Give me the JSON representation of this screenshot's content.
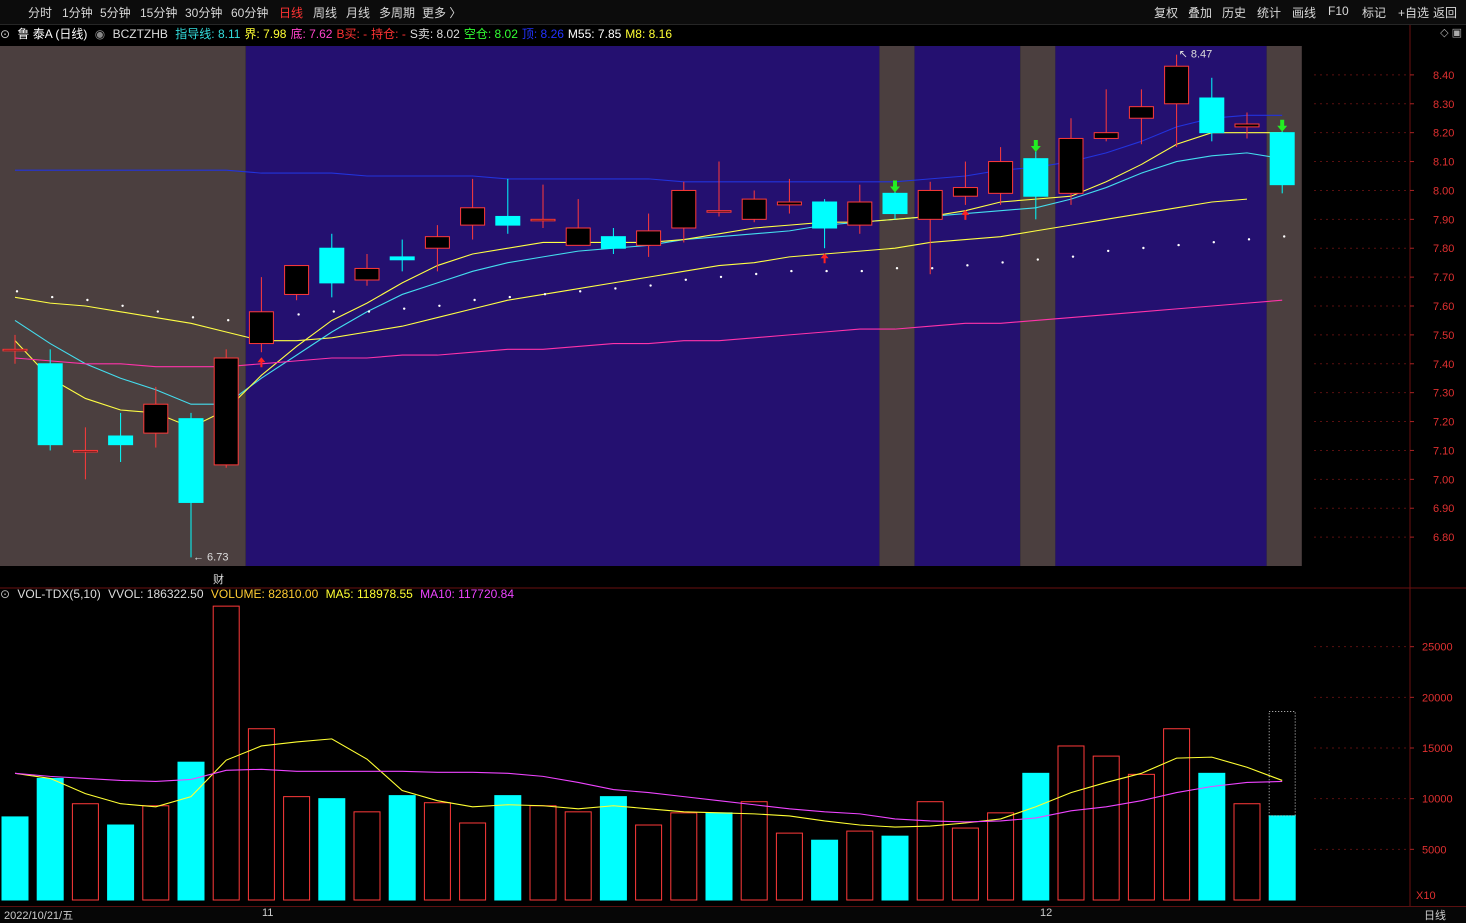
{
  "toolbar": {
    "left": [
      {
        "id": "fenshi",
        "label": "分时",
        "active": false
      },
      {
        "id": "1min",
        "label": "1分钟",
        "active": false
      },
      {
        "id": "5min",
        "label": "5分钟",
        "active": false
      },
      {
        "id": "15min",
        "label": "15分钟",
        "active": false
      },
      {
        "id": "30min",
        "label": "30分钟",
        "active": false
      },
      {
        "id": "60min",
        "label": "60分钟",
        "active": false
      },
      {
        "id": "day",
        "label": "日线",
        "active": true
      },
      {
        "id": "week",
        "label": "周线",
        "active": false
      },
      {
        "id": "month",
        "label": "月线",
        "active": false
      },
      {
        "id": "multi",
        "label": "多周期",
        "active": false
      },
      {
        "id": "more",
        "label": "更多 〉",
        "active": false
      }
    ],
    "right": [
      {
        "id": "fuquan",
        "label": "复权"
      },
      {
        "id": "diejia",
        "label": "叠加"
      },
      {
        "id": "lishi",
        "label": "历史"
      },
      {
        "id": "tongji",
        "label": "统计"
      },
      {
        "id": "huaxian",
        "label": "画线"
      },
      {
        "id": "f10",
        "label": "F10"
      },
      {
        "id": "biaoji",
        "label": "标记"
      },
      {
        "id": "zixuan",
        "label": "+自选"
      },
      {
        "id": "fanhui",
        "label": "返回"
      }
    ]
  },
  "info": {
    "stock": "鲁 泰A (日线)",
    "code": "BCZTZHB",
    "items": [
      {
        "label": "指导线:",
        "value": "8.11",
        "color": "#33dddd"
      },
      {
        "label": "界:",
        "value": "7.98",
        "color": "#ffff33"
      },
      {
        "label": "底:",
        "value": "7.62",
        "color": "#ff44cc"
      },
      {
        "label": "B买:",
        "value": "-",
        "color": "#ff3333"
      },
      {
        "label": "持仓:",
        "value": "-",
        "color": "#ff3333"
      },
      {
        "label": "S卖:",
        "value": "8.02",
        "color": "#dddddd"
      },
      {
        "label": "空仓:",
        "value": "8.02",
        "color": "#33ff33"
      },
      {
        "label": "顶:",
        "value": "8.26",
        "color": "#2233ff"
      },
      {
        "label": "M55:",
        "value": "7.85",
        "color": "#ffffff"
      },
      {
        "label": "M8:",
        "value": "8.16",
        "color": "#ffff33"
      }
    ]
  },
  "vol_info": {
    "name": "VOL-TDX(5,10)",
    "vvol": "VVOL: 186322.50",
    "volume": "VOLUME: 82810.00",
    "ma5": "MA5: 118978.55",
    "ma10": "MA10: 117720.84"
  },
  "annotations": {
    "high": "8.47",
    "low": "6.73",
    "cai": "财",
    "x10": "X10"
  },
  "dates": {
    "first": "2022/10/21/五",
    "m11": "11",
    "m12": "12",
    "period": "日线"
  },
  "colors": {
    "up": "#ff3a3a",
    "down": "#00ffff",
    "bg_gray": "#4b3f3f",
    "bg_blue": "#241070",
    "ma_white": "#ffffff",
    "ma_yellow": "#ffff44",
    "ma_cyan": "#44ddee",
    "ma_blue": "#2233dd",
    "ma_magenta": "#ff33aa"
  },
  "chart_data": [
    {
      "type": "candlestick",
      "title": "鲁 泰A (日线)",
      "ylim": [
        6.7,
        8.5
      ],
      "yticks": [
        6.8,
        6.9,
        7.0,
        7.1,
        7.2,
        7.3,
        7.4,
        7.5,
        7.6,
        7.7,
        7.8,
        7.9,
        8.0,
        8.1,
        8.2,
        8.3,
        8.4
      ],
      "candles": [
        {
          "o": 7.45,
          "c": 7.45,
          "h": 7.5,
          "l": 7.4
        },
        {
          "o": 7.4,
          "c": 7.12,
          "h": 7.45,
          "l": 7.1
        },
        {
          "o": 7.1,
          "c": 7.1,
          "h": 7.18,
          "l": 7.0
        },
        {
          "o": 7.15,
          "c": 7.12,
          "h": 7.23,
          "l": 7.06
        },
        {
          "o": 7.16,
          "c": 7.26,
          "h": 7.32,
          "l": 7.11
        },
        {
          "o": 7.21,
          "c": 6.92,
          "h": 7.23,
          "l": 6.73
        },
        {
          "o": 7.05,
          "c": 7.42,
          "h": 7.45,
          "l": 7.04
        },
        {
          "o": 7.47,
          "c": 7.58,
          "h": 7.7,
          "l": 7.44
        },
        {
          "o": 7.64,
          "c": 7.74,
          "h": 7.74,
          "l": 7.62
        },
        {
          "o": 7.8,
          "c": 7.68,
          "h": 7.85,
          "l": 7.63
        },
        {
          "o": 7.69,
          "c": 7.73,
          "h": 7.78,
          "l": 7.67
        },
        {
          "o": 7.77,
          "c": 7.76,
          "h": 7.83,
          "l": 7.72
        },
        {
          "o": 7.8,
          "c": 7.84,
          "h": 7.88,
          "l": 7.72
        },
        {
          "o": 7.88,
          "c": 7.94,
          "h": 8.04,
          "l": 7.83
        },
        {
          "o": 7.91,
          "c": 7.88,
          "h": 8.04,
          "l": 7.85
        },
        {
          "o": 7.9,
          "c": 7.9,
          "h": 8.02,
          "l": 7.87
        },
        {
          "o": 7.81,
          "c": 7.87,
          "h": 7.97,
          "l": 7.81
        },
        {
          "o": 7.84,
          "c": 7.8,
          "h": 7.87,
          "l": 7.78
        },
        {
          "o": 7.81,
          "c": 7.86,
          "h": 7.92,
          "l": 7.77
        },
        {
          "o": 7.87,
          "c": 8.0,
          "h": 8.03,
          "l": 7.82
        },
        {
          "o": 7.93,
          "c": 7.93,
          "h": 8.1,
          "l": 7.91
        },
        {
          "o": 7.9,
          "c": 7.97,
          "h": 8.0,
          "l": 7.89
        },
        {
          "o": 7.95,
          "c": 7.96,
          "h": 8.04,
          "l": 7.92
        },
        {
          "o": 7.96,
          "c": 7.87,
          "h": 7.97,
          "l": 7.8
        },
        {
          "o": 7.88,
          "c": 7.96,
          "h": 8.02,
          "l": 7.85
        },
        {
          "o": 7.99,
          "c": 7.92,
          "h": 8.0,
          "l": 7.9
        },
        {
          "o": 7.9,
          "c": 8.0,
          "h": 8.03,
          "l": 7.71
        },
        {
          "o": 7.98,
          "c": 8.01,
          "h": 8.1,
          "l": 7.95
        },
        {
          "o": 7.99,
          "c": 8.1,
          "h": 8.15,
          "l": 7.95
        },
        {
          "o": 8.11,
          "c": 7.98,
          "h": 8.14,
          "l": 7.9
        },
        {
          "o": 7.99,
          "c": 8.18,
          "h": 8.25,
          "l": 7.95
        },
        {
          "o": 8.18,
          "c": 8.2,
          "h": 8.35,
          "l": 8.17
        },
        {
          "o": 8.25,
          "c": 8.29,
          "h": 8.35,
          "l": 8.16
        },
        {
          "o": 8.3,
          "c": 8.43,
          "h": 8.47,
          "l": 8.15
        },
        {
          "o": 8.32,
          "c": 8.2,
          "h": 8.39,
          "l": 8.17
        },
        {
          "o": 8.22,
          "c": 8.23,
          "h": 8.27,
          "l": 8.18
        },
        {
          "o": 8.2,
          "c": 8.02,
          "h": 8.21,
          "l": 7.99
        }
      ],
      "ma_white_dots": [
        7.63,
        7.61,
        7.6,
        7.58,
        7.56,
        7.54,
        7.53,
        7.55,
        7.55,
        7.56,
        7.56,
        7.57,
        7.58,
        7.6,
        7.61,
        7.62,
        7.63,
        7.64,
        7.65,
        7.67,
        7.68,
        7.69,
        7.7,
        7.7,
        7.7,
        7.71,
        7.71,
        7.72,
        7.73,
        7.74,
        7.75,
        7.77,
        7.78,
        7.79,
        7.8,
        7.81,
        7.82
      ],
      "series": [
        {
          "color_key": "ma_yellow",
          "values": [
            7.63,
            7.61,
            7.6,
            7.58,
            7.56,
            7.54,
            7.51,
            7.48,
            7.48,
            7.49,
            7.51,
            7.53,
            7.56,
            7.59,
            7.62,
            7.64,
            7.66,
            7.68,
            7.7,
            7.72,
            7.74,
            7.75,
            7.77,
            7.78,
            7.79,
            7.8,
            7.82,
            7.83,
            7.84,
            7.86,
            7.88,
            7.9,
            7.92,
            7.94,
            7.96,
            7.97
          ]
        },
        {
          "color_key": "ma_cyan",
          "values": [
            7.55,
            7.47,
            7.4,
            7.35,
            7.31,
            7.26,
            7.26,
            7.35,
            7.43,
            7.51,
            7.58,
            7.64,
            7.68,
            7.72,
            7.75,
            7.77,
            7.79,
            7.8,
            7.81,
            7.83,
            7.84,
            7.85,
            7.86,
            7.88,
            7.89,
            7.9,
            7.91,
            7.92,
            7.93,
            7.94,
            7.97,
            8.01,
            8.06,
            8.1,
            8.12,
            8.13,
            8.11
          ]
        },
        {
          "color_key": "ma_yellow",
          "values": [
            7.48,
            7.35,
            7.28,
            7.24,
            7.23,
            7.18,
            7.24,
            7.36,
            7.46,
            7.55,
            7.61,
            7.68,
            7.74,
            7.78,
            7.8,
            7.82,
            7.82,
            7.82,
            7.82,
            7.83,
            7.85,
            7.87,
            7.88,
            7.89,
            7.89,
            7.9,
            7.91,
            7.93,
            7.96,
            7.97,
            7.98,
            8.03,
            8.09,
            8.16,
            8.2,
            8.2,
            8.2
          ]
        },
        {
          "color_key": "ma_blue",
          "values": [
            8.07,
            8.07,
            8.07,
            8.07,
            8.07,
            8.07,
            8.07,
            8.06,
            8.06,
            8.06,
            8.05,
            8.05,
            8.05,
            8.05,
            8.04,
            8.04,
            8.04,
            8.04,
            8.04,
            8.03,
            8.03,
            8.03,
            8.03,
            8.03,
            8.03,
            8.03,
            8.04,
            8.05,
            8.07,
            8.08,
            8.1,
            8.13,
            8.17,
            8.22,
            8.25,
            8.26,
            8.26
          ]
        },
        {
          "color_key": "ma_magenta",
          "values": [
            7.42,
            7.41,
            7.4,
            7.4,
            7.39,
            7.39,
            7.39,
            7.4,
            7.41,
            7.42,
            7.42,
            7.43,
            7.43,
            7.44,
            7.45,
            7.45,
            7.46,
            7.47,
            7.47,
            7.48,
            7.48,
            7.49,
            7.5,
            7.51,
            7.52,
            7.52,
            7.53,
            7.54,
            7.54,
            7.55,
            7.56,
            7.57,
            7.58,
            7.59,
            7.6,
            7.61,
            7.62
          ]
        }
      ],
      "signals": [
        {
          "index": 7,
          "type": "buy"
        },
        {
          "index": 23,
          "type": "buy"
        },
        {
          "index": 27,
          "type": "buy"
        },
        {
          "index": 25,
          "type": "sell"
        },
        {
          "index": 29,
          "type": "sell"
        },
        {
          "index": 36,
          "type": "sell"
        }
      ],
      "bg_zones": [
        {
          "from": 0,
          "to": 6,
          "kind": "gray"
        },
        {
          "from": 7,
          "to": 24,
          "kind": "blue"
        },
        {
          "from": 25,
          "to": 25,
          "kind": "gray"
        },
        {
          "from": 26,
          "to": 28,
          "kind": "blue"
        },
        {
          "from": 29,
          "to": 29,
          "kind": "gray"
        },
        {
          "from": 30,
          "to": 35,
          "kind": "blue"
        },
        {
          "from": 36,
          "to": 36,
          "kind": "gray"
        }
      ]
    },
    {
      "type": "bar",
      "title": "VOL-TDX(5,10)",
      "ylim": [
        0,
        30000
      ],
      "yticks": [
        5000,
        10000,
        15000,
        20000,
        25000
      ],
      "unit_label": "X10",
      "values": [
        8200,
        12000,
        9500,
        7400,
        9300,
        13600,
        29000,
        16900,
        10200,
        10000,
        8700,
        10300,
        9600,
        7600,
        10300,
        9300,
        8700,
        10200,
        7400,
        8600,
        8600,
        9700,
        6600,
        5900,
        6800,
        6300,
        9700,
        7100,
        8600,
        12500,
        15200,
        14200,
        12400,
        16900,
        12500,
        9500,
        8300
      ],
      "direction": [
        "down",
        "down",
        "up",
        "down",
        "up",
        "down",
        "up",
        "up",
        "up",
        "down",
        "up",
        "down",
        "up",
        "up",
        "down",
        "up",
        "up",
        "down",
        "up",
        "up",
        "down",
        "up",
        "up",
        "down",
        "up",
        "down",
        "up",
        "up",
        "up",
        "down",
        "up",
        "up",
        "up",
        "up",
        "down",
        "up",
        "down"
      ],
      "series": [
        {
          "name": "MA5",
          "color": "#ffff33",
          "values": [
            12500,
            12000,
            10500,
            9500,
            9200,
            10200,
            13800,
            15200,
            15600,
            15900,
            13900,
            10800,
            9800,
            9200,
            9400,
            9300,
            9000,
            9300,
            9000,
            8700,
            8600,
            8500,
            8300,
            7800,
            7400,
            7200,
            7300,
            7600,
            8000,
            9200,
            10600,
            11600,
            12500,
            14000,
            14100,
            13100,
            11800
          ]
        },
        {
          "name": "MA10",
          "color": "#ee44ff",
          "values": [
            12500,
            12200,
            12000,
            11800,
            11700,
            11900,
            12800,
            12900,
            12700,
            12700,
            12700,
            12700,
            12600,
            12600,
            12500,
            12200,
            11600,
            10900,
            10600,
            10200,
            9800,
            9400,
            9000,
            8700,
            8500,
            8000,
            7800,
            7700,
            7800,
            8100,
            8800,
            9200,
            9800,
            10600,
            11200,
            11600,
            11700
          ]
        }
      ]
    }
  ]
}
